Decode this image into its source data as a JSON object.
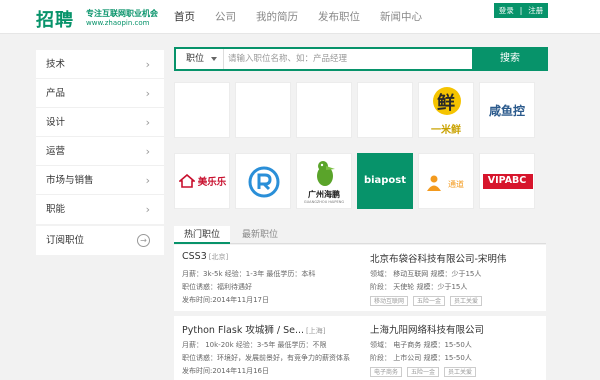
{
  "header": {
    "logo_main": "招聘",
    "logo_slogan": "专注互联网职业机会",
    "logo_url": "www.zhaopin.com",
    "nav": [
      "首页",
      "公司",
      "我的简历",
      "发布职位",
      "新闻中心"
    ],
    "login": "登录",
    "register": "注册",
    "auth_sep": "|"
  },
  "sidebar": {
    "items": [
      {
        "label": "技术",
        "icon": "chevron-right-icon"
      },
      {
        "label": "产品",
        "icon": "chevron-right-icon"
      },
      {
        "label": "设计",
        "icon": "chevron-right-icon"
      },
      {
        "label": "运营",
        "icon": "chevron-right-icon"
      },
      {
        "label": "市场与销售",
        "icon": "chevron-right-icon"
      },
      {
        "label": "职能",
        "icon": "chevron-right-icon"
      }
    ],
    "subscribe_label": "订阅职位",
    "subscribe_icon": "arrow-right-circle-icon",
    "chevron": "›",
    "subscribe_glyph": "→"
  },
  "search": {
    "select_value": "职位",
    "placeholder": "请输入职位名称、如：产品经理",
    "button": "搜索"
  },
  "company_logos": {
    "row2": {
      "meilele": "美乐乐",
      "haipeng_name": "广州海鹏",
      "haipeng_sub": "GUANGZHOU HAIPENG",
      "biapost": "biapost",
      "tongdao": "通道",
      "vipabc": "VIPABC"
    },
    "row1": {
      "yimixian_char": "鲜",
      "yimixian_name": "一米鲜",
      "xianyukong": "咸鱼控"
    }
  },
  "tabs": [
    "热门职位",
    "最新职位"
  ],
  "jobs": [
    {
      "title": "CSS3",
      "location": "[北京]",
      "salary_line": "月薪：3k-5k   经验：1-3年   最低学历：本科",
      "benefit_line": "职位诱惑：福利待遇好",
      "date_line": "发布时间:2014年11月17日",
      "company": "北京布袋谷科技有限公司-宋明伟",
      "field_line": "领域：   移动互联网   规模：少于15人",
      "stage_line": "阶段：   天使轮   规模：少于15人",
      "tags": [
        "移动互联网",
        "五险一金",
        "员工关爱"
      ]
    },
    {
      "title": "Python Flask 攻城狮 / Se...",
      "location": "[上海]",
      "salary_line": "月薪：   10k-20k   经验：3-5年   最低学历：不限",
      "benefit_line": "职位诱惑：环境好，发展前景好，有竞争力的薪资体系",
      "date_line": "发布时间:2014年11月16日",
      "company": "上海九阳网络科技有限公司",
      "field_line": "领域：   电子商务   规模：15-50人",
      "stage_line": "阶段：   上市公司   规模：15-50人",
      "tags": [
        "电子商务",
        "五险一金",
        "员工关爱"
      ]
    }
  ],
  "colors": {
    "brand": "#07936a"
  }
}
